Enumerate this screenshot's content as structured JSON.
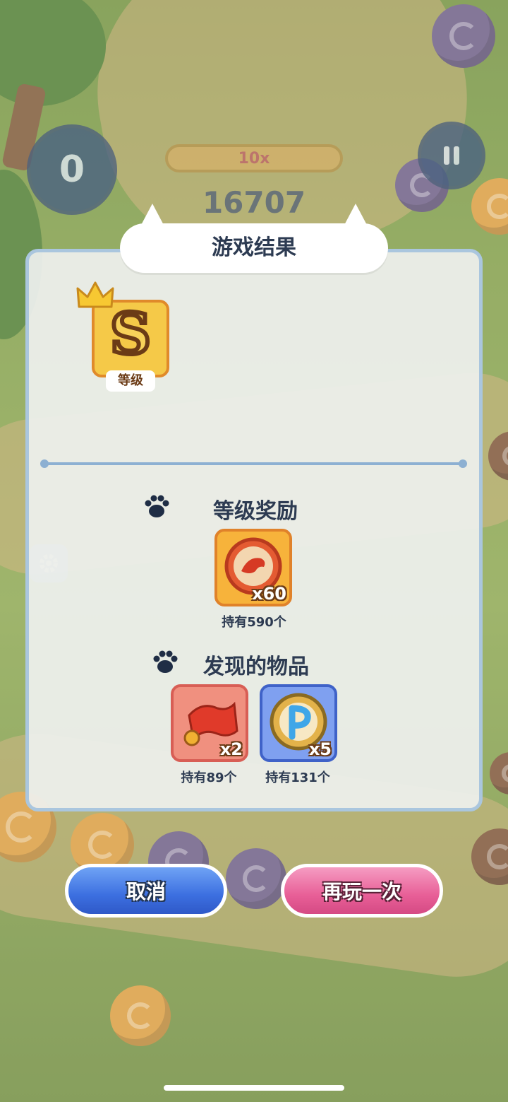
{
  "hud": {
    "counter": "0",
    "multiplier": "10x",
    "score": "16707"
  },
  "result_dialog": {
    "title": "游戏结果",
    "grade": {
      "letter": "S",
      "label": "等级"
    },
    "grade_reward": {
      "heading": "等级奖励",
      "items": [
        {
          "icon": "pavilion-red-coin-icon",
          "quantity": "x60",
          "owned": "持有590个"
        }
      ]
    },
    "found_items": {
      "heading": "发现的物品",
      "items": [
        {
          "icon": "red-scroll-icon",
          "quantity": "x2",
          "owned": "持有89个"
        },
        {
          "icon": "pavilion-blue-coin-icon",
          "quantity": "x5",
          "owned": "持有131个"
        }
      ]
    }
  },
  "buttons": {
    "cancel": "取消",
    "play_again": "再玩一次"
  },
  "colors": {
    "panel_border": "#aac6de",
    "cancel_button": "#3c6fe0",
    "play_again_button": "#e85f97",
    "grade_gold": "#f5c948",
    "title_text": "#2d3b52"
  }
}
